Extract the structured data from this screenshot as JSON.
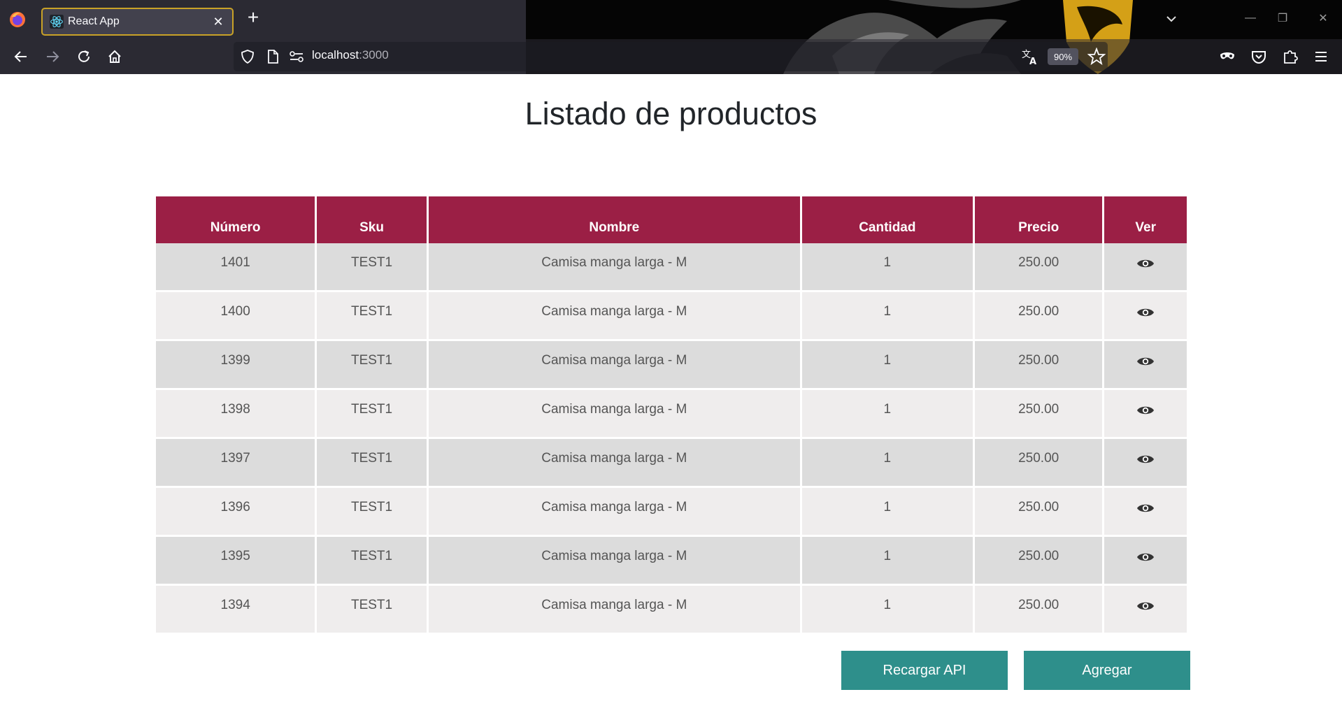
{
  "browser": {
    "tab_title": "React App",
    "url_host": "localhost",
    "url_port": ":3000",
    "zoom": "90%",
    "new_tab_label": "+",
    "accent_color": "#c9a227"
  },
  "page": {
    "title": "Listado de productos",
    "header_color": "#9b1f45",
    "button_color": "#2e8f8b"
  },
  "table": {
    "columns": [
      "Número",
      "Sku",
      "Nombre",
      "Cantidad",
      "Precio",
      "Ver"
    ],
    "rows": [
      {
        "numero": "1401",
        "sku": "TEST1",
        "nombre": "Camisa manga larga - M",
        "cantidad": "1",
        "precio": "250.00"
      },
      {
        "numero": "1400",
        "sku": "TEST1",
        "nombre": "Camisa manga larga - M",
        "cantidad": "1",
        "precio": "250.00"
      },
      {
        "numero": "1399",
        "sku": "TEST1",
        "nombre": "Camisa manga larga - M",
        "cantidad": "1",
        "precio": "250.00"
      },
      {
        "numero": "1398",
        "sku": "TEST1",
        "nombre": "Camisa manga larga - M",
        "cantidad": "1",
        "precio": "250.00"
      },
      {
        "numero": "1397",
        "sku": "TEST1",
        "nombre": "Camisa manga larga - M",
        "cantidad": "1",
        "precio": "250.00"
      },
      {
        "numero": "1396",
        "sku": "TEST1",
        "nombre": "Camisa manga larga - M",
        "cantidad": "1",
        "precio": "250.00"
      },
      {
        "numero": "1395",
        "sku": "TEST1",
        "nombre": "Camisa manga larga - M",
        "cantidad": "1",
        "precio": "250.00"
      },
      {
        "numero": "1394",
        "sku": "TEST1",
        "nombre": "Camisa manga larga - M",
        "cantidad": "1",
        "precio": "250.00"
      }
    ]
  },
  "actions": {
    "reload_label": "Recargar API",
    "add_label": "Agregar"
  }
}
